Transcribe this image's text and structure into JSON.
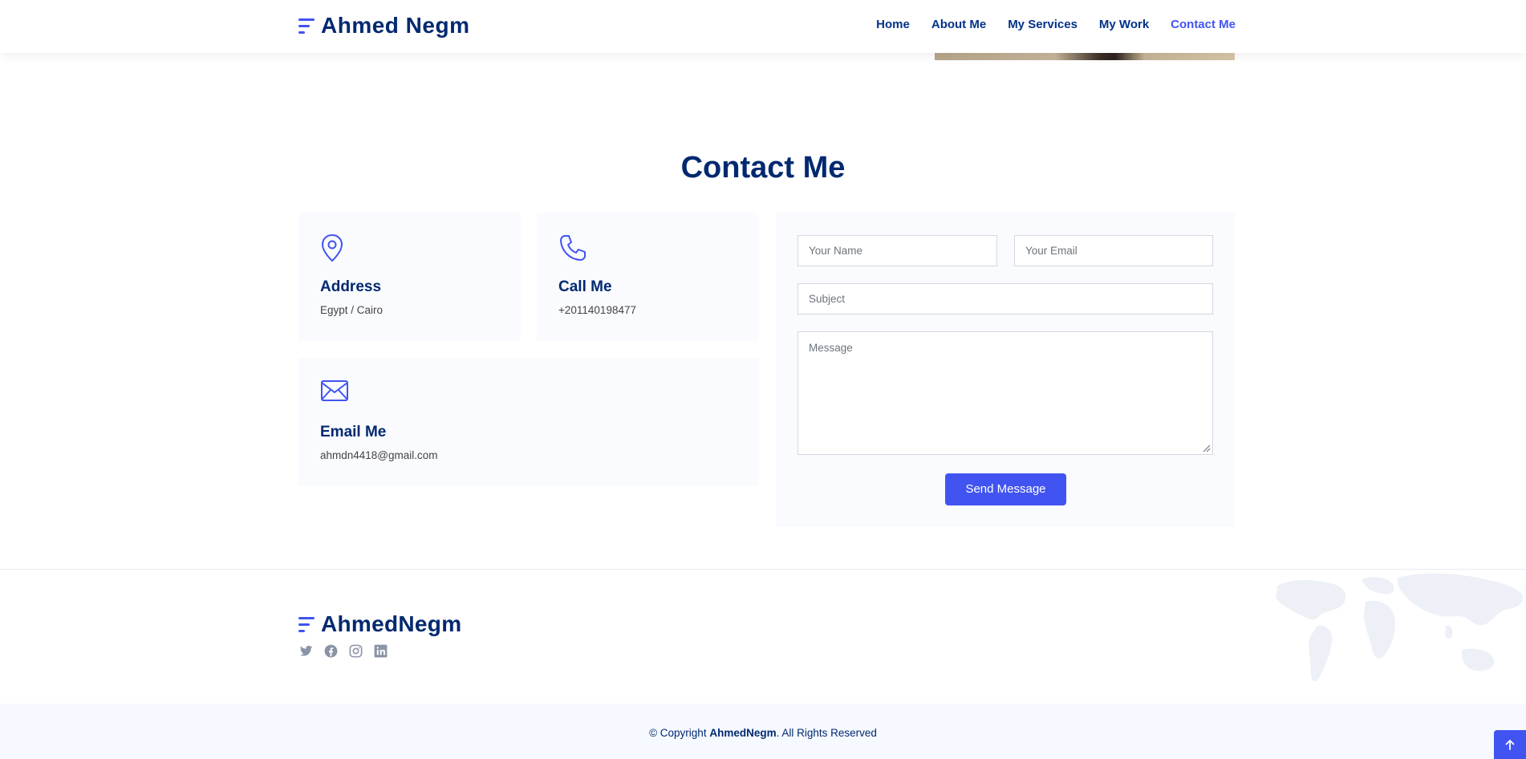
{
  "header": {
    "logo_text": "Ahmed Negm",
    "nav": [
      {
        "label": "Home"
      },
      {
        "label": "About Me"
      },
      {
        "label": "My Services"
      },
      {
        "label": "My Work"
      },
      {
        "label": "Contact Me",
        "active": true
      }
    ]
  },
  "contact": {
    "title": "Contact Me",
    "address": {
      "icon": "geo-pin-icon",
      "heading": "Address",
      "value": "Egypt / Cairo"
    },
    "call": {
      "icon": "phone-icon",
      "heading": "Call Me",
      "value": "+201140198477"
    },
    "email": {
      "icon": "envelope-icon",
      "heading": "Email Me",
      "value": "ahmdn4418@gmail.com"
    },
    "form": {
      "name_placeholder": "Your Name",
      "email_placeholder": "Your Email",
      "subject_placeholder": "Subject",
      "message_placeholder": "Message",
      "submit_label": "Send Message"
    }
  },
  "footer": {
    "logo_text": "AhmedNegm",
    "socials": [
      "twitter-icon",
      "facebook-icon",
      "instagram-icon",
      "linkedin-icon"
    ],
    "copyright_prefix": "© Copyright ",
    "copyright_brand": "AhmedNegm",
    "copyright_suffix": ". All Rights Reserved"
  },
  "colors": {
    "brand_dark": "#012970",
    "accent": "#4154f1",
    "box_bg": "#fafbff"
  }
}
